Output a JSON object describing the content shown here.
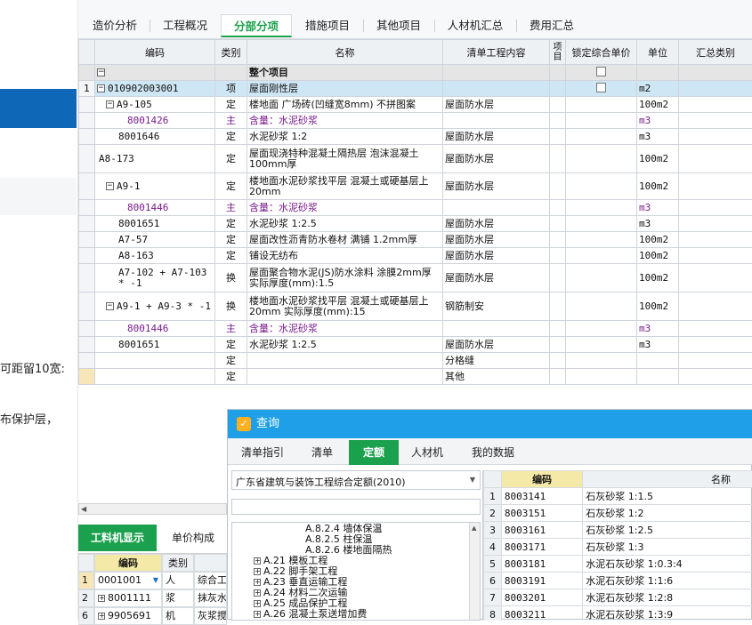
{
  "left_strip": {
    "text_1": "可距留10宽:",
    "text_2": "布保护层，"
  },
  "tabs": [
    {
      "label": "造价分析"
    },
    {
      "label": "工程概况"
    },
    {
      "label": "分部分项"
    },
    {
      "label": "措施项目"
    },
    {
      "label": "其他项目"
    },
    {
      "label": "人材机汇总"
    },
    {
      "label": "费用汇总"
    }
  ],
  "grid": {
    "headers": [
      "编码",
      "类别",
      "名称",
      "清单工程内容",
      "项目",
      "锁定综合单价",
      "单位",
      "汇总类别"
    ],
    "whole_project": "整个项目",
    "rows": [
      {
        "idx": "1",
        "code": "010902003001",
        "type": "项",
        "name": "屋面刚性层",
        "content": "",
        "unit": "m2",
        "purple": false
      },
      {
        "idx": "",
        "code": "A9-105",
        "type": "定",
        "name": "楼地面 广场砖(凹缝宽8mm) 不拼图案",
        "content": "屋面防水层",
        "unit": "100m2",
        "purple": false
      },
      {
        "idx": "",
        "code": "8001426",
        "type": "主",
        "name": "含量：水泥砂浆",
        "content": "",
        "unit": "m3",
        "purple": true
      },
      {
        "idx": "",
        "code": "8001646",
        "type": "定",
        "name": "水泥砂浆 1:2",
        "content": "屋面防水层",
        "unit": "m3",
        "purple": false
      },
      {
        "idx": "",
        "code": "A8-173",
        "type": "定",
        "name": "屋面现浇特种混凝土隔热层 泡沫混凝土 100mm厚",
        "content": "屋面防水层",
        "unit": "100m2",
        "purple": false
      },
      {
        "idx": "",
        "code": "A9-1",
        "type": "定",
        "name": "楼地面水泥砂浆找平层 混凝土或硬基层上 20mm",
        "content": "屋面防水层",
        "unit": "100m2",
        "purple": false
      },
      {
        "idx": "",
        "code": "8001446",
        "type": "主",
        "name": "含量：水泥砂浆",
        "content": "",
        "unit": "m3",
        "purple": true
      },
      {
        "idx": "",
        "code": "8001651",
        "type": "定",
        "name": "水泥砂浆 1:2.5",
        "content": "屋面防水层",
        "unit": "m3",
        "purple": false
      },
      {
        "idx": "",
        "code": "A7-57",
        "type": "定",
        "name": "屋面改性沥青防水卷材 满铺 1.2mm厚",
        "content": "屋面防水层",
        "unit": "100m2",
        "purple": false
      },
      {
        "idx": "",
        "code": "A8-163",
        "type": "定",
        "name": "铺设无纺布",
        "content": "屋面防水层",
        "unit": "100m2",
        "purple": false
      },
      {
        "idx": "",
        "code": "A7-102 + A7-103 * -1",
        "type": "换",
        "name": "屋面聚合物水泥(JS)防水涂料 涂膜2mm厚  实际厚度(mm):1.5",
        "content": "屋面防水层",
        "unit": "100m2",
        "purple": false
      },
      {
        "idx": "",
        "code": "A9-1 + A9-3 * -1",
        "type": "换",
        "name": "楼地面水泥砂浆找平层 混凝土或硬基层上 20mm  实际厚度(mm):15",
        "content": "钢筋制安",
        "unit": "100m2",
        "purple": false
      },
      {
        "idx": "",
        "code": "8001446",
        "type": "主",
        "name": "含量：水泥砂浆",
        "content": "",
        "unit": "m3",
        "purple": true
      },
      {
        "idx": "",
        "code": "8001651",
        "type": "定",
        "name": "水泥砂浆 1:2.5",
        "content": "屋面防水层",
        "unit": "m3",
        "purple": false
      },
      {
        "idx": "",
        "code": "",
        "type": "定",
        "name": "",
        "content": "分格缝",
        "unit": "",
        "purple": false
      },
      {
        "idx": "",
        "code": "",
        "type": "定",
        "name": "",
        "content": "其他",
        "unit": "",
        "purple": false
      }
    ]
  },
  "bottom_left": {
    "tab_active": "工料机显示",
    "tab_2": "单价构成",
    "col_code": "编码",
    "col_type": "类别",
    "rows": [
      {
        "idx": "1",
        "code": "0001001",
        "type": "人",
        "name": "综合工"
      },
      {
        "idx": "2",
        "code": "8001111",
        "type": "浆",
        "name": "抹灰水"
      },
      {
        "idx": "6",
        "code": "9905691",
        "type": "机",
        "name": "灰浆搅"
      }
    ]
  },
  "dialog": {
    "title": "查询",
    "tabs": [
      {
        "label": "清单指引"
      },
      {
        "label": "清单"
      },
      {
        "label": "定额"
      },
      {
        "label": "人材机"
      },
      {
        "label": "我的数据"
      }
    ],
    "select_value": "广东省建筑与装饰工程综合定额(2010)",
    "search_placeholder": "",
    "tree": [
      {
        "label": "A.8.2.4 墙体保温",
        "level": 2
      },
      {
        "label": "A.8.2.5 柱保温",
        "level": 2
      },
      {
        "label": "A.8.2.6 楼地面隔热",
        "level": 2
      },
      {
        "label": "A.21 模板工程",
        "level": 1
      },
      {
        "label": "A.22 脚手架工程",
        "level": 1
      },
      {
        "label": "A.23 垂直运输工程",
        "level": 1
      },
      {
        "label": "A.24 材料二次运输",
        "level": 1
      },
      {
        "label": "A.25 成品保护工程",
        "level": 1
      },
      {
        "label": "A.26 混凝土泵送增加费",
        "level": 1
      }
    ],
    "result_headers": [
      "编码",
      "名称"
    ],
    "results": [
      {
        "idx": "1",
        "code": "8003141",
        "name": "石灰砂浆 1:1.5"
      },
      {
        "idx": "2",
        "code": "8003151",
        "name": "石灰砂浆 1:2"
      },
      {
        "idx": "3",
        "code": "8003161",
        "name": "石灰砂浆 1:2.5"
      },
      {
        "idx": "4",
        "code": "8003171",
        "name": "石灰砂浆 1:3"
      },
      {
        "idx": "5",
        "code": "8003181",
        "name": "水泥石灰砂浆 1:0.3:4"
      },
      {
        "idx": "6",
        "code": "8003191",
        "name": "水泥石灰砂浆 1:1:6"
      },
      {
        "idx": "7",
        "code": "8003201",
        "name": "水泥石灰砂浆 1:2:8"
      },
      {
        "idx": "8",
        "code": "8003211",
        "name": "水泥石灰砂浆 1:3:9"
      }
    ]
  },
  "colors": {
    "accent_green": "#1ba14d",
    "dialog_blue": "#1e9fe8",
    "sidebar_blue": "#0f67b8",
    "row_selected": "#cfe7f5",
    "purple_text": "#7a1a8c"
  }
}
